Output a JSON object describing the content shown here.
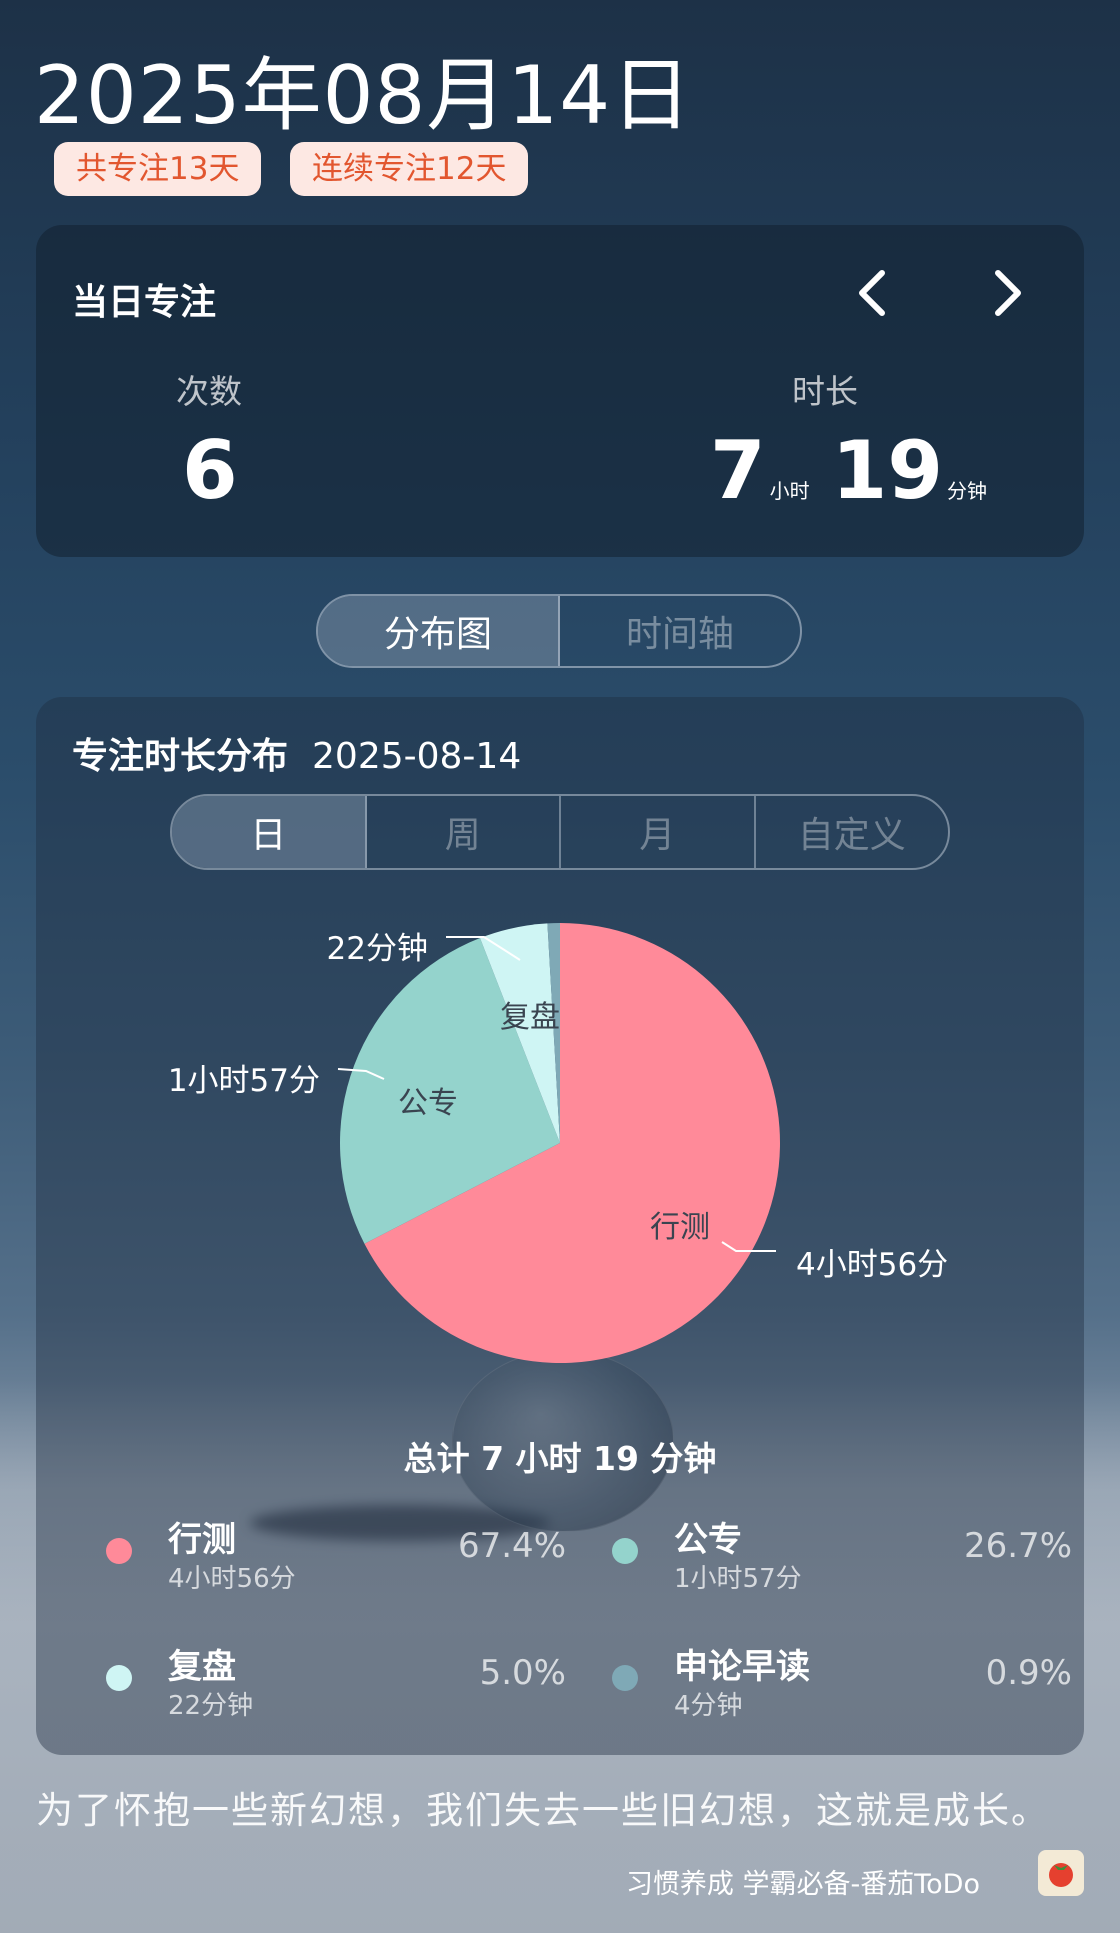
{
  "header": {
    "date": "2025年08月14日",
    "badges": [
      "共专注13天",
      "连续专注12天"
    ]
  },
  "today": {
    "title": "当日专注",
    "count_label": "次数",
    "count": "6",
    "duration_label": "时长",
    "hours": "7",
    "hours_unit": "小时",
    "minutes": "19",
    "minutes_unit": "分钟"
  },
  "view_toggle": {
    "options": [
      "分布图",
      "时间轴"
    ],
    "selected": "分布图"
  },
  "distribution": {
    "title": "专注时长分布",
    "date": "2025-08-14",
    "ranges": [
      "日",
      "周",
      "月",
      "自定义"
    ],
    "selected_range": "日",
    "total": "总计 7 小时 19 分钟"
  },
  "chart_data": {
    "type": "pie",
    "categories": [
      "行测",
      "公专",
      "复盘",
      "申论早读"
    ],
    "values": [
      296,
      117,
      22,
      4
    ],
    "value_labels": [
      "4小时56分",
      "1小时57分",
      "22分钟",
      "4分钟"
    ],
    "percent_labels": [
      "67.4%",
      "26.7%",
      "5.0%",
      "0.9%"
    ],
    "colors": [
      "#ff8a99",
      "#94d3cc",
      "#cff5f4",
      "#7fa9b6"
    ]
  },
  "quote": "为了怀抱一些新幻想，我们失去一些旧幻想，这就是成长。",
  "footer": {
    "text": "习惯养成 学霸必备-番茄ToDo"
  }
}
